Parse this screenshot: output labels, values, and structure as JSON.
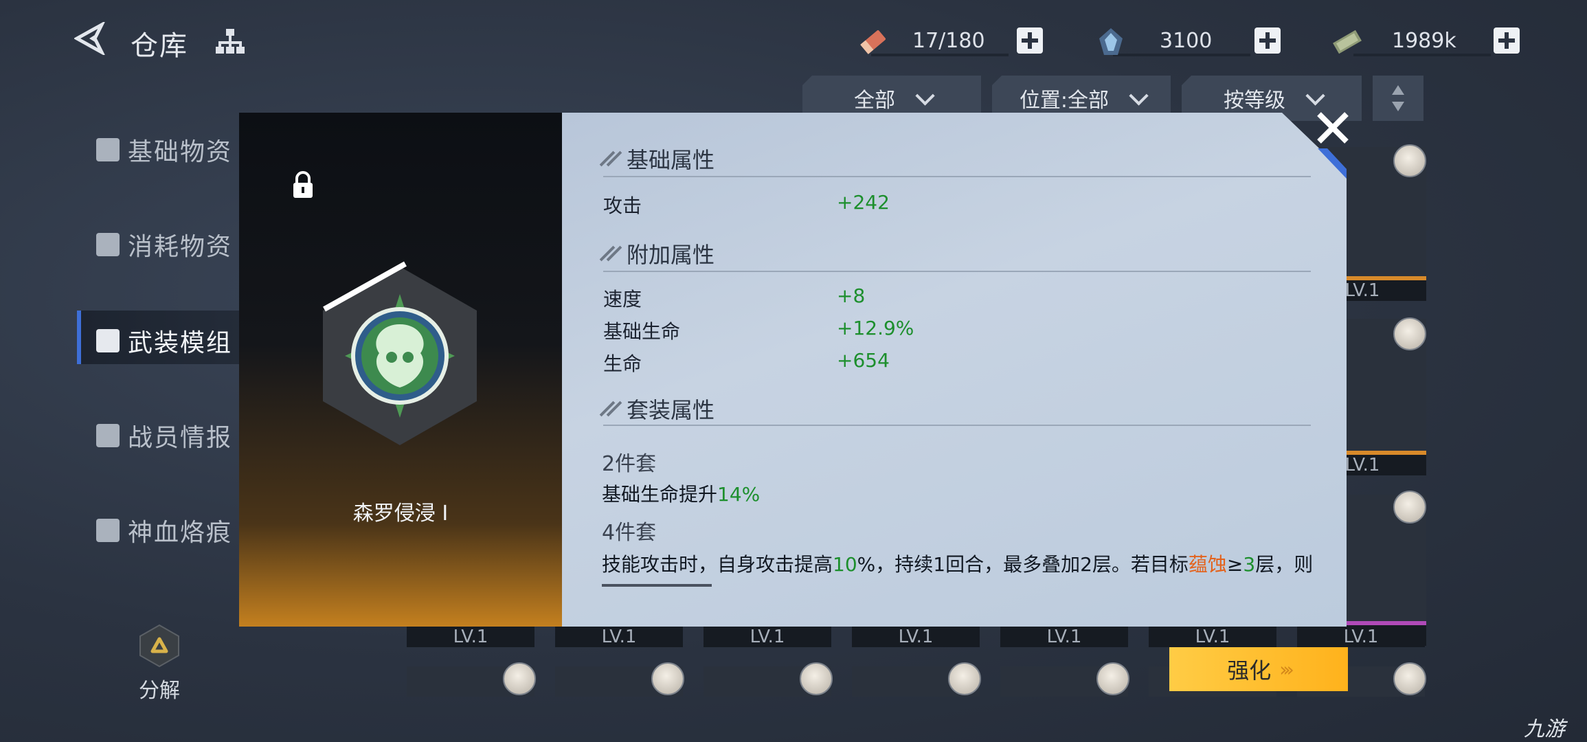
{
  "header": {
    "title": "仓库",
    "resources": [
      {
        "icon": "ticket-icon",
        "value": "17/180"
      },
      {
        "icon": "crystal-icon",
        "value": "3100"
      },
      {
        "icon": "cash-icon",
        "value": "1989k"
      }
    ]
  },
  "filters": {
    "category": "全部",
    "position": "位置:全部",
    "sort": "按等级"
  },
  "sidebar": {
    "items": [
      {
        "label": "基础物资",
        "icon": "cube-icon"
      },
      {
        "label": "消耗物资",
        "icon": "box-icon"
      },
      {
        "label": "武装模组",
        "icon": "module-icon",
        "active": true
      },
      {
        "label": "战员情报",
        "icon": "card-icon"
      },
      {
        "label": "神血烙痕",
        "icon": "star-icon"
      }
    ],
    "decompose_label": "分解"
  },
  "grid": {
    "level_label": "LV.1"
  },
  "modal": {
    "item_name": "森罗侵浸 I",
    "sections": {
      "base": "基础属性",
      "extra": "附加属性",
      "set": "套装属性"
    },
    "base_attrs": [
      {
        "name": "攻击",
        "value": "+242"
      }
    ],
    "extra_attrs": [
      {
        "name": "速度",
        "value": "+8"
      },
      {
        "name": "基础生命",
        "value": "+12.9%"
      },
      {
        "name": "生命",
        "value": "+654"
      }
    ],
    "set_bonus": {
      "two_piece_title": "2件套",
      "two_piece_text": "基础生命提升",
      "two_piece_value": "14%",
      "four_piece_title": "4件套",
      "four_piece_parts": [
        "技能攻击时，自身攻击提高",
        "10",
        "%，持续1回合，最多叠加2层。若目标",
        "蕴蚀",
        "≥",
        "3",
        "层，则"
      ]
    },
    "enhance_label": "强化"
  },
  "watermark": "九游",
  "colors": {
    "accent_blue": "#3e6fd8",
    "value_green": "#1d8f2d",
    "keyword_orange": "#e3621c",
    "button_yellow": "#ffbf30"
  }
}
